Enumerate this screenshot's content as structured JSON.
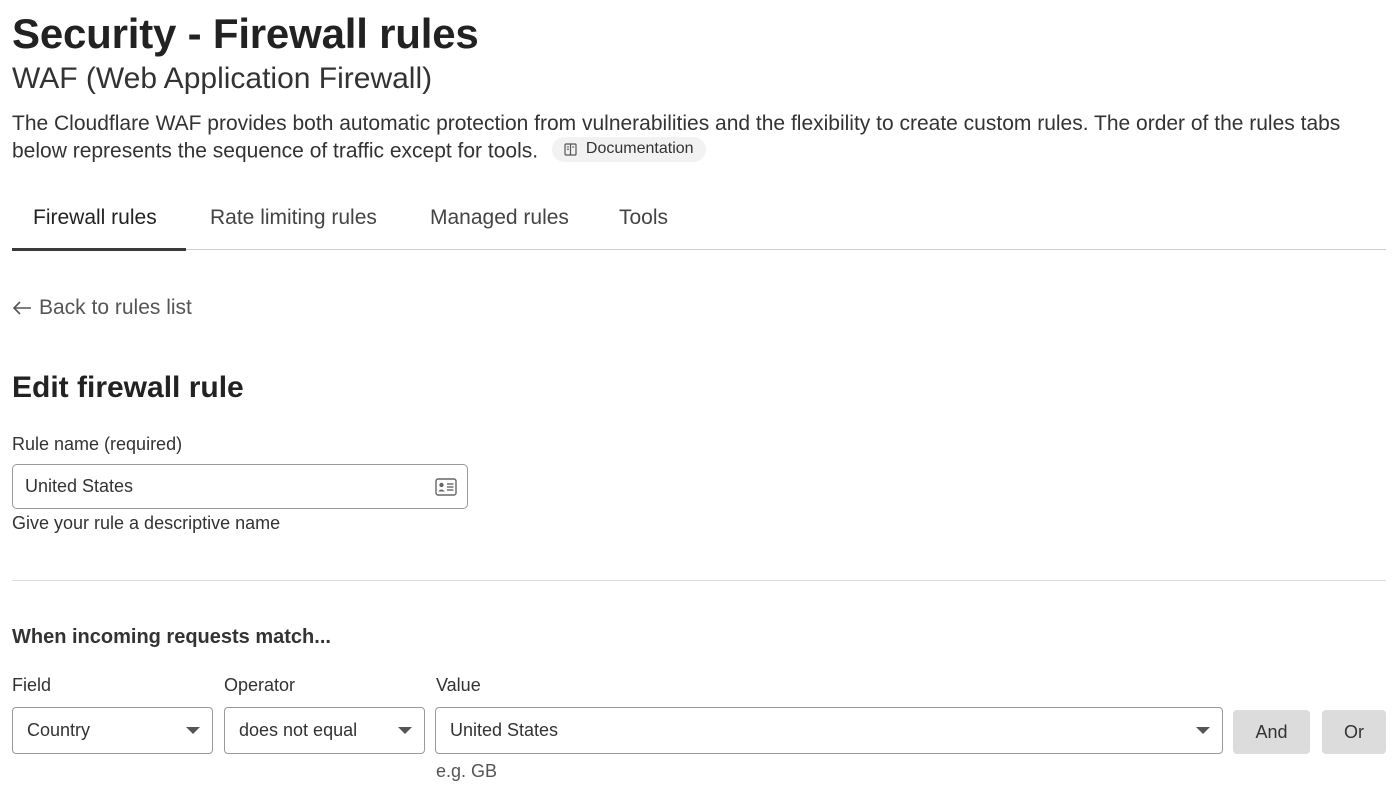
{
  "header": {
    "title": "Security - Firewall rules",
    "subtitle": "WAF (Web Application Firewall)",
    "description": "The Cloudflare WAF provides both automatic protection from vulnerabilities and the flexibility to create custom rules. The order of the rules tabs below represents the sequence of traffic except for tools.",
    "doc_link": {
      "label": "Documentation",
      "icon": "book-icon"
    }
  },
  "tabs": [
    {
      "label": "Firewall rules",
      "active": true
    },
    {
      "label": "Rate limiting rules",
      "active": false
    },
    {
      "label": "Managed rules",
      "active": false
    },
    {
      "label": "Tools",
      "active": false
    }
  ],
  "back_link": {
    "label": "Back to rules list",
    "icon": "arrow-left-icon"
  },
  "form": {
    "title": "Edit firewall rule",
    "rule_name": {
      "label": "Rule name (required)",
      "value": "United States",
      "icon": "contact-card-icon",
      "hint": "Give your rule a descriptive name"
    },
    "match_title": "When incoming requests match...",
    "expression": {
      "field_label": "Field",
      "field_value": "Country",
      "operator_label": "Operator",
      "operator_value": "does not equal",
      "value_label": "Value",
      "value_value": "United States",
      "value_hint": "e.g. GB"
    },
    "and_label": "And",
    "or_label": "Or"
  }
}
